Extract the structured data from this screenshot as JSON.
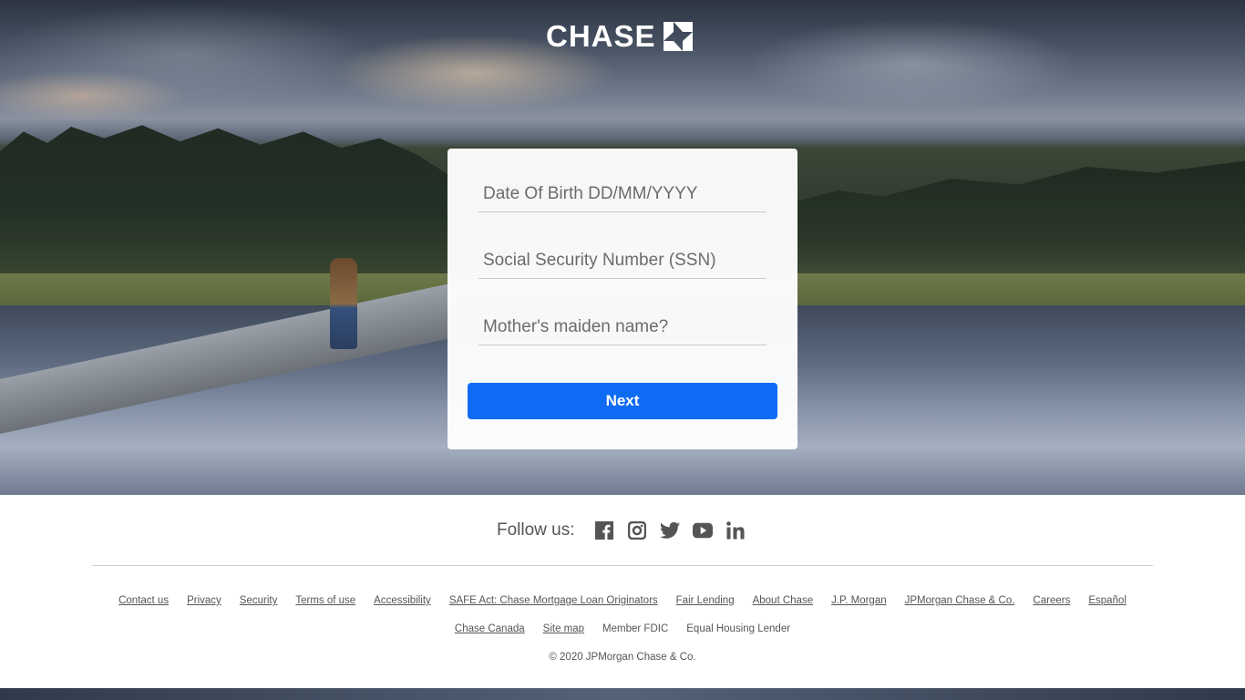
{
  "brand": {
    "name": "CHASE"
  },
  "form": {
    "dob_placeholder": "Date Of Birth DD/MM/YYYY",
    "ssn_placeholder": "Social Security Number (SSN)",
    "maiden_placeholder": "Mother's maiden name?",
    "next_label": "Next"
  },
  "footer": {
    "follow_label": "Follow us:",
    "social_icons": [
      "facebook-icon",
      "instagram-icon",
      "twitter-icon",
      "youtube-icon",
      "linkedin-icon"
    ],
    "links_row1": [
      "Contact us",
      "Privacy",
      "Security",
      "Terms of use",
      "Accessibility",
      "SAFE Act: Chase Mortgage Loan Originators",
      "Fair Lending",
      "About Chase",
      "J.P. Morgan",
      "JPMorgan Chase & Co.",
      "Careers",
      "Español"
    ],
    "links_row2": [
      "Chase Canada",
      "Site map"
    ],
    "static_row2": [
      "Member FDIC",
      "Equal Housing Lender"
    ],
    "copyright": "© 2020 JPMorgan Chase & Co."
  },
  "colors": {
    "primary_button": "#0f6cf5",
    "footer_text": "#555555"
  }
}
